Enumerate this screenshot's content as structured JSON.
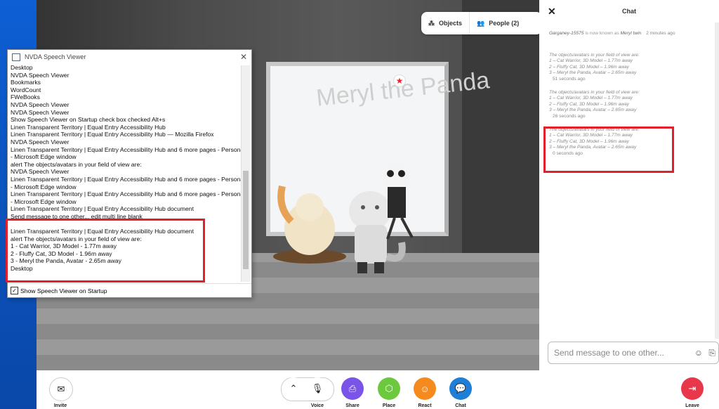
{
  "nvda": {
    "title": "NVDA Speech Viewer",
    "lines": [
      "Desktop",
      "NVDA Speech Viewer",
      "Bookmarks",
      "WordCount",
      "FWeBooks",
      "NVDA Speech Viewer",
      "NVDA Speech Viewer",
      "Show Speech Viewer on Startup  check box  checked  Alt+s",
      "Linen Transparent Territory | Equal Entry Accessibility Hub",
      "Linen Transparent Territory | Equal Entry Accessibility Hub — Mozilla Firefox",
      "NVDA Speech Viewer",
      "Linen Transparent Territory | Equal Entry Accessibility Hub and 6 more pages - Personal",
      "- Microsoft Edge  window",
      "alert  The objects/avatars in your field of view are:",
      "NVDA Speech Viewer",
      "Linen Transparent Territory | Equal Entry Accessibility Hub and 6 more pages - Personal",
      "- Microsoft Edge  window",
      "Linen Transparent Territory | Equal Entry Accessibility Hub and 6 more pages - Personal",
      "- Microsoft Edge  window",
      "Linen Transparent Territory | Equal Entry Accessibility Hub  document",
      "Send message to one other...  edit  multi line  blank",
      "",
      "Linen Transparent Territory | Equal Entry Accessibility Hub  document",
      "alert  The objects/avatars in your field of view are:",
      "1 - Cat Warrior, 3D Model - 1.77m away",
      "2 - Fluffy Cat, 3D Model - 1.96m away",
      "3 - Meryl the Panda, Avatar - 2.65m away",
      "Desktop"
    ],
    "footer_checkbox": "Show Speech Viewer on Startup"
  },
  "scene": {
    "board_text": "Meryl the Panda"
  },
  "topbar": {
    "objects_label": "Objects",
    "people_label": "People (2)"
  },
  "chat": {
    "title": "Chat",
    "rename": {
      "old": "Garganey-15575",
      "middle": " is now known as ",
      "new": "Meryl twin",
      "time": "2 minutes ago"
    },
    "messages": [
      {
        "head": "The objects/avatars in your field of view are:",
        "l1": "1 – Cat Warrior, 3D Model – 1.77m away",
        "l2": "2 – Fluffy Cat, 3D Model – 1.96m away",
        "l3": "3 – Meryl the Panda, Avatar – 2.65m away",
        "time": "51 seconds ago"
      },
      {
        "head": "The objects/avatars in your field of view are:",
        "l1": "1 – Cat Warrior, 3D Model – 1.77m away",
        "l2": "2 – Fluffy Cat, 3D Model – 1.96m away",
        "l3": "3 – Meryl the Panda, Avatar – 2.65m away",
        "time": "26 seconds ago"
      },
      {
        "head": "The objects/avatars in your field of view are:",
        "l1": "1 – Cat Warrior, 3D Model – 1.77m away",
        "l2": "2 – Fluffy Cat, 3D Model – 1.96m away",
        "l3": "3 – Meryl the Panda, Avatar – 2.65m away",
        "time": "0 seconds ago"
      }
    ],
    "input_placeholder": "Send message to one other..."
  },
  "toolbar": {
    "invite": "Invite",
    "voice": "Voice",
    "share": "Share",
    "place": "Place",
    "react": "React",
    "chat": "Chat",
    "leave": "Leave"
  },
  "colors": {
    "highlight": "#e0202a",
    "share": "#7a54e8",
    "place": "#6cc83c",
    "react": "#f58a1f",
    "chat": "#1f7fd6",
    "leave": "#e8364b"
  }
}
